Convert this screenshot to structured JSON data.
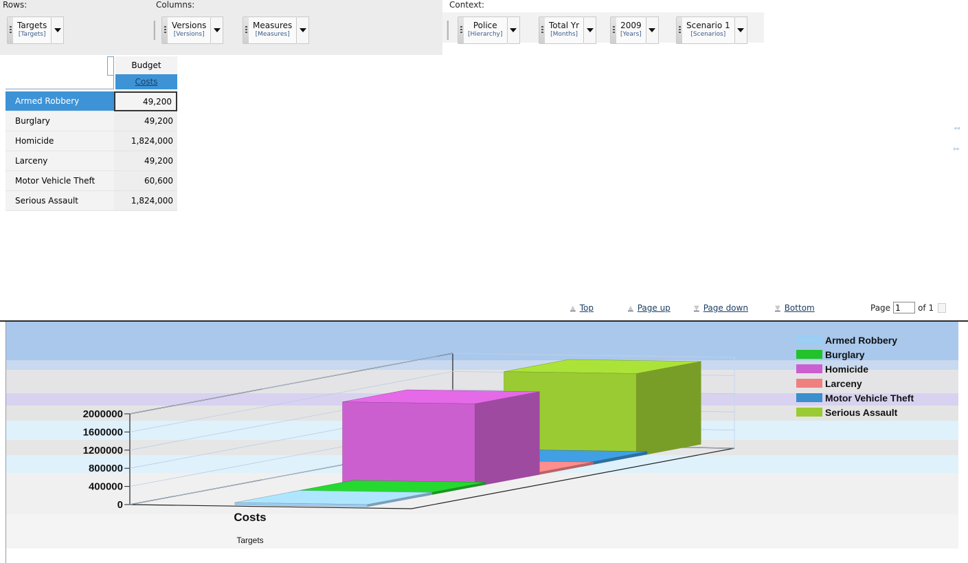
{
  "dimension_bar": {
    "rows_label": "Rows:",
    "columns_label": "Columns:",
    "context_label": "Context:",
    "rows": [
      {
        "name": "Targets",
        "sub": "[Targets]"
      }
    ],
    "columns": [
      {
        "name": "Versions",
        "sub": "[Versions]"
      },
      {
        "name": "Measures",
        "sub": "[Measures]"
      }
    ],
    "context": [
      {
        "name": "Police",
        "sub": "[Hierarchy]"
      },
      {
        "name": "Total Yr",
        "sub": "[Months]"
      },
      {
        "name": "2009",
        "sub": "[Years]"
      },
      {
        "name": "Scenario 1",
        "sub": "[Scenarios]"
      }
    ]
  },
  "grid": {
    "column_header_top": "Budget",
    "column_header_sub": "Costs",
    "rows": [
      {
        "label": "Armed Robbery",
        "value": "49,200",
        "selected": true
      },
      {
        "label": "Burglary",
        "value": "49,200",
        "selected": false
      },
      {
        "label": "Homicide",
        "value": "1,824,000",
        "selected": false
      },
      {
        "label": "Larceny",
        "value": "49,200",
        "selected": false
      },
      {
        "label": "Motor Vehicle Theft",
        "value": "60,600",
        "selected": false
      },
      {
        "label": "Serious Assault",
        "value": "1,824,000",
        "selected": false
      }
    ],
    "side_arrows": [
      "◂◂",
      "▸▸"
    ]
  },
  "pager": {
    "top": "Top",
    "page_up": "Page up",
    "page_down": "Page down",
    "bottom": "Bottom",
    "page_label": "Page",
    "page_value": "1",
    "of_label": "of 1"
  },
  "chart_data": {
    "type": "bar",
    "categories": [
      "Costs"
    ],
    "xlabel": "Targets",
    "ylabel": "",
    "ylim": [
      0,
      2000000
    ],
    "yticks": [
      "0",
      "400000",
      "800000",
      "1200000",
      "1600000",
      "2000000"
    ],
    "legend_position": "top-right",
    "series": [
      {
        "name": "Armed Robbery",
        "values": [
          49200
        ],
        "color": "#9ccdf2"
      },
      {
        "name": "Burglary",
        "values": [
          49200
        ],
        "color": "#22c22b"
      },
      {
        "name": "Homicide",
        "values": [
          1824000
        ],
        "color": "#cc5fcf"
      },
      {
        "name": "Larceny",
        "values": [
          49200
        ],
        "color": "#f07f7f"
      },
      {
        "name": "Motor Vehicle Theft",
        "values": [
          60600
        ],
        "color": "#3a8fcc"
      },
      {
        "name": "Serious Assault",
        "values": [
          1824000
        ],
        "color": "#9acb32"
      }
    ]
  }
}
